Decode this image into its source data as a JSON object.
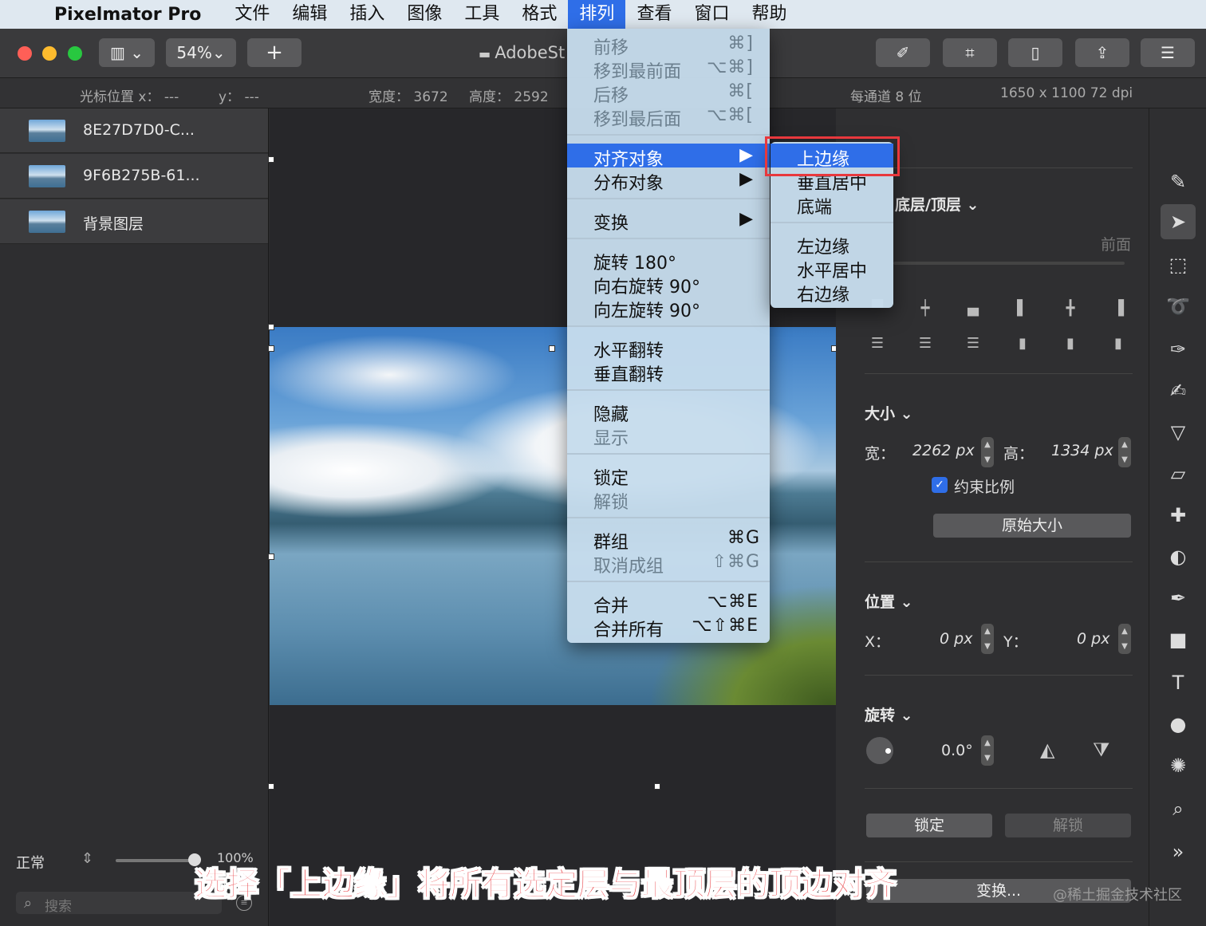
{
  "menubar": {
    "app": "Pixelmator Pro",
    "items": [
      "文件",
      "编辑",
      "插入",
      "图像",
      "工具",
      "格式",
      "排列",
      "查看",
      "窗口",
      "帮助"
    ]
  },
  "toolbar": {
    "zoom": "54%",
    "add": "+",
    "doc_title": "AdobeSt"
  },
  "infobar": {
    "cursor_x": "光标位置 x：  ---",
    "cursor_y": "y：  ---",
    "width": "宽度：  3672",
    "height": "高度：  2592",
    "bits": "每通道 8 位",
    "resolution": "1650 x 1100 72 dpi"
  },
  "layers": [
    {
      "name": "8E27D7D0-C..."
    },
    {
      "name": "9F6B275B-61..."
    },
    {
      "name": "背景图层"
    }
  ],
  "layers_footer": {
    "blend": "正常",
    "opacity": "100%",
    "opacity_value": 1.0,
    "search_placeholder": "搜索"
  },
  "arrange_menu": [
    {
      "label": "前移",
      "shortcut": "⌘]",
      "disabled": true
    },
    {
      "label": "移到最前面",
      "shortcut": "⌥⌘]",
      "disabled": true
    },
    {
      "label": "后移",
      "shortcut": "⌘[",
      "disabled": true
    },
    {
      "label": "移到最后面",
      "shortcut": "⌥⌘[",
      "disabled": true
    },
    {
      "label": "对齐对象",
      "shortcut": "▶",
      "highlighted": true
    },
    {
      "label": "分布对象",
      "shortcut": "▶"
    },
    {
      "label": "变换",
      "shortcut": "▶"
    },
    {
      "label": "旋转 180°",
      "shortcut": ""
    },
    {
      "label": "向右旋转 90°",
      "shortcut": ""
    },
    {
      "label": "向左旋转 90°",
      "shortcut": ""
    },
    {
      "label": "水平翻转",
      "shortcut": ""
    },
    {
      "label": "垂直翻转",
      "shortcut": ""
    },
    {
      "label": "隐藏",
      "shortcut": ""
    },
    {
      "label": "显示",
      "shortcut": "",
      "disabled": true
    },
    {
      "label": "锁定",
      "shortcut": ""
    },
    {
      "label": "解锁",
      "shortcut": "",
      "disabled": true
    },
    {
      "label": "群组",
      "shortcut": "⌘G"
    },
    {
      "label": "取消成组",
      "shortcut": "⇧⌘G",
      "disabled": true
    },
    {
      "label": "合并",
      "shortcut": "⌥⌘E"
    },
    {
      "label": "合并所有",
      "shortcut": "⌥⇧⌘E"
    }
  ],
  "align_submenu": [
    "上边缘",
    "垂直居中",
    "底端",
    "左边缘",
    "水平居中",
    "右边缘"
  ],
  "panel": {
    "arrange_label": "底层/顶层 ⌄",
    "front_label": "前面",
    "size_header": "大小 ⌄",
    "w_label": "宽：",
    "w_value": "2262 px",
    "h_label": "高：",
    "h_value": "1334 px",
    "constrain": "约束比例",
    "original": "原始大小",
    "position_header": "位置 ⌄",
    "x_label": "X：",
    "x_value": "0 px",
    "y_label": "Y：",
    "y_value": "0 px",
    "rotate_header": "旋转 ⌄",
    "rotate_value": "0.0°",
    "lock": "锁定",
    "unlock": "解锁",
    "transform": "变换..."
  },
  "caption": "选择「上边缘」将所有选定层与最顶层的顶边对齐",
  "watermark": "@稀土掘金技术社区",
  "colors": {
    "accent": "#2f6ee8",
    "highlight_box": "#e8383d"
  }
}
